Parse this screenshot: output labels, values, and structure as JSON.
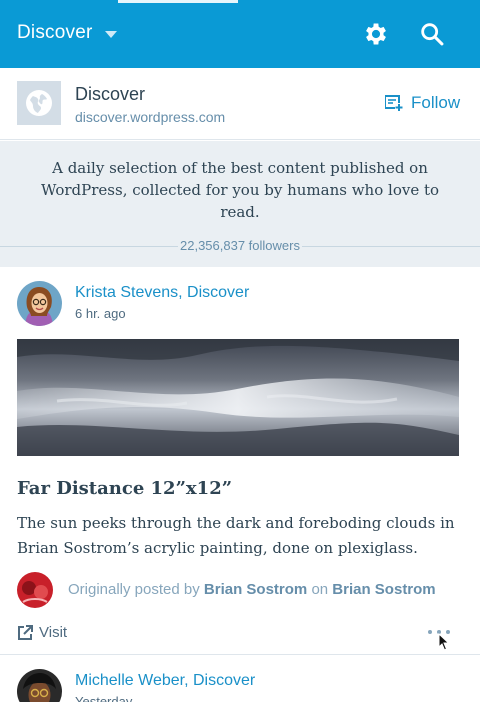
{
  "topbar": {
    "title": "Discover",
    "icons": [
      "chevron-down-icon",
      "gear-icon",
      "search-icon"
    ],
    "color": "#0a9ad5"
  },
  "site": {
    "name": "Discover",
    "url": "discover.wordpress.com",
    "icon": "globe-icon",
    "follow_label": "Follow",
    "follow_icon": "reader-follow-icon",
    "description": "A daily selection of the best content published on WordPress, collected for you by humans who love to read.",
    "followers": "22,356,837 followers"
  },
  "posts": [
    {
      "author": "Krista Stevens, Discover",
      "time": "6 hr. ago",
      "title": "Far Distance 12”x12”",
      "excerpt": "The sun peeks through the dark and foreboding clouds in Brian Sostrom’s acrylic painting, done on plexiglass.",
      "originally_posted_by_prefix": "Originally posted by",
      "original_author": "Brian Sostrom",
      "on_word": "on",
      "original_site": "Brian Sostrom",
      "visit_label": "Visit",
      "visit_icon": "external-link-icon",
      "more_icon": "ellipsis-icon"
    },
    {
      "author": "Michelle Weber, Discover",
      "time": "Yesterday"
    }
  ],
  "colors": {
    "link": "#1a90c8",
    "text": "#2e4453",
    "muted": "#87a6bc",
    "background_band": "#eaeff3"
  }
}
